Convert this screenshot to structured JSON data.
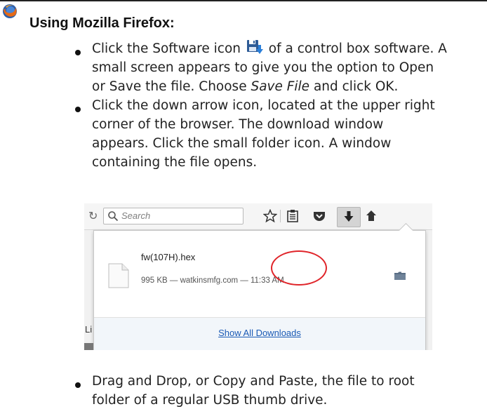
{
  "heading": "Using Mozilla Firefox:",
  "icons": {
    "browser": "firefox-icon",
    "software": "software-download-icon"
  },
  "steps": {
    "step1": {
      "line1_before_icon": "Click the Software icon",
      "line1_after_icon": "of a control box software. A",
      "line2": "small screen appears to give you the option to Open",
      "line3_before": "or Save the file. Choose ",
      "line3_em": "Save File",
      "line3_after": " and click OK."
    },
    "step2": {
      "line1": "Click the down arrow icon, located at the upper right",
      "line2": "corner of the browser. The download window",
      "line3": "appears. Click the small folder icon. A window",
      "line4": "containing the file opens."
    },
    "step3": {
      "line1": "Drag and Drop, or Copy and Paste, the file to root",
      "line2": "folder of a regular USB thumb drive."
    }
  },
  "browser": {
    "search_placeholder": "Search",
    "download": {
      "file_name": "fw(107H).hex",
      "file_meta": "995 KB — watkinsmfg.com — 11:33 AM",
      "show_all": "Show All Downloads"
    },
    "side_text": "Li"
  },
  "colors": {
    "highlight_circle": "#e0252a",
    "link": "#1a5ab5"
  }
}
